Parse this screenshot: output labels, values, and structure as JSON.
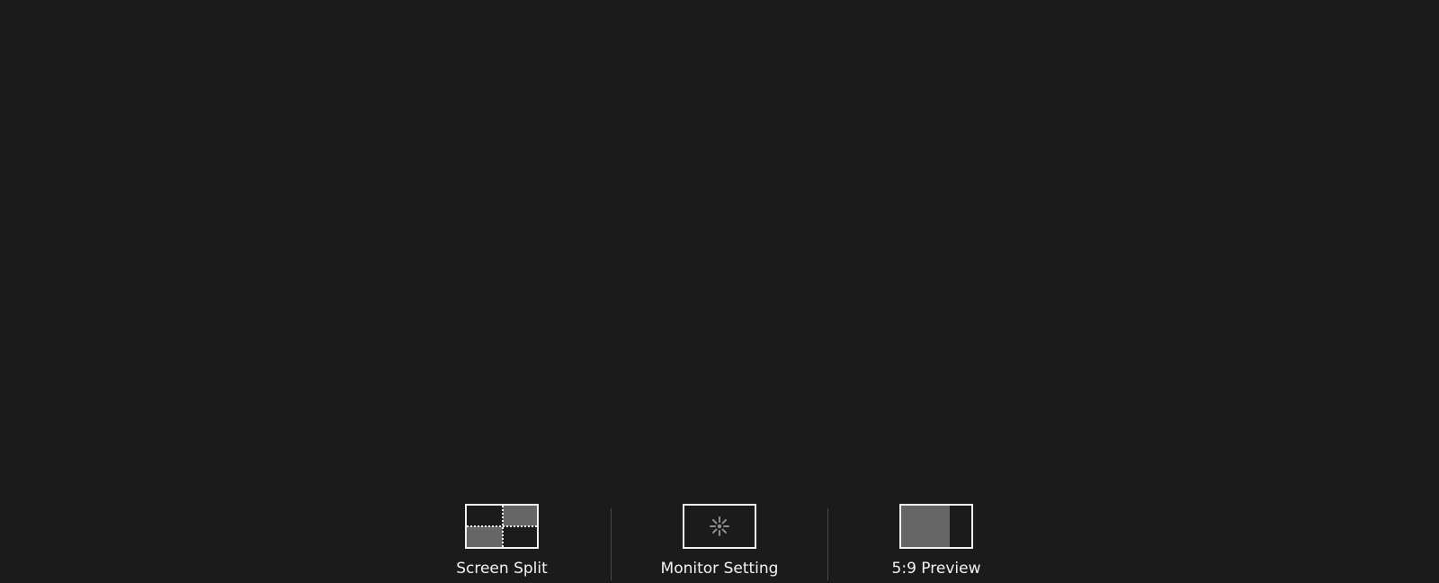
{
  "toolbar": {
    "items": [
      {
        "label": "Screen Split",
        "icon": "screen-split-icon"
      },
      {
        "label": "Monitor Setting",
        "icon": "settings-icon"
      },
      {
        "label": "5:9 Preview",
        "icon": "preview-icon"
      }
    ]
  },
  "colors": {
    "background": "#1b1b1b",
    "icon_stroke": "#f1f1f1",
    "icon_fill": "#666666",
    "divider": "#4a4a4a",
    "label": "#f3f3f3"
  }
}
